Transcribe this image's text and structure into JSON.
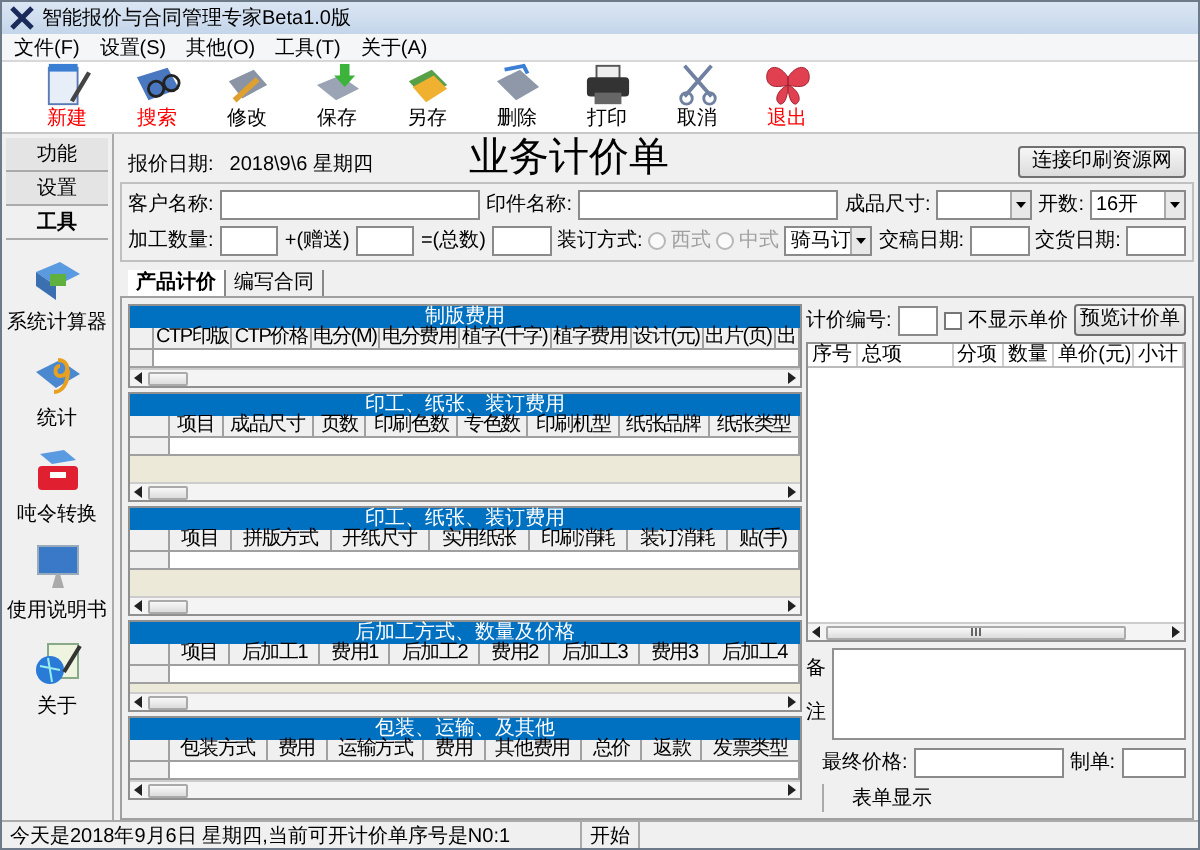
{
  "window": {
    "title": "智能报价与合同管理专家Beta1.0版"
  },
  "menu": [
    "文件(F)",
    "设置(S)",
    "其他(O)",
    "工具(T)",
    "关于(A)"
  ],
  "toolbar": [
    {
      "label": "新建",
      "kind": "new",
      "color": "#ff0000"
    },
    {
      "label": "搜索",
      "kind": "search",
      "color": "#ff0000"
    },
    {
      "label": "修改",
      "kind": "edit",
      "color": "#000000"
    },
    {
      "label": "保存",
      "kind": "save",
      "color": "#000000"
    },
    {
      "label": "另存",
      "kind": "saveas",
      "color": "#000000"
    },
    {
      "label": "删除",
      "kind": "delete",
      "color": "#000000"
    },
    {
      "label": "打印",
      "kind": "print",
      "color": "#000000"
    },
    {
      "label": "取消",
      "kind": "cancel",
      "color": "#000000"
    },
    {
      "label": "退出",
      "kind": "exit",
      "color": "#ff0000"
    }
  ],
  "sidebar": {
    "tabs": [
      {
        "label": "功能",
        "selected": false
      },
      {
        "label": "设置",
        "selected": false
      },
      {
        "label": "工具",
        "selected": true
      }
    ],
    "items": [
      {
        "label": "系统计算器",
        "kind": "computer"
      },
      {
        "label": "统计",
        "kind": "nine"
      },
      {
        "label": "吨令转换",
        "kind": "toolbox"
      },
      {
        "label": "使用说明书",
        "kind": "monitor"
      },
      {
        "label": "关于",
        "kind": "globe"
      }
    ]
  },
  "header": {
    "date_label": "报价日期:",
    "date": "2018\\9\\6 星期四",
    "title": "业务计价单",
    "link_button": "连接印刷资源网"
  },
  "form": {
    "top_fields": [
      {
        "kind": "text",
        "label": "客户名称:"
      },
      {
        "kind": "text",
        "label": "印件名称:"
      },
      {
        "kind": "select",
        "label": "成品尺寸:"
      },
      {
        "kind": "select",
        "label": "开数:",
        "value": "16开"
      }
    ],
    "bottom_fields": [
      {
        "kind": "text",
        "label": "加工数量:"
      },
      {
        "kind": "text",
        "label": "+(赠送)"
      },
      {
        "kind": "text",
        "label": "=(总数)"
      },
      {
        "kind": "radio_group",
        "label": "装订方式:",
        "options": [
          {
            "label": "西式",
            "selected": false,
            "disabled": true
          },
          {
            "label": "中式",
            "selected": false,
            "disabled": true
          }
        ]
      },
      {
        "kind": "select",
        "value": "骑马订"
      },
      {
        "kind": "text",
        "label": "交稿日期:"
      },
      {
        "kind": "text",
        "label": "交货日期:"
      }
    ]
  },
  "tabs": [
    {
      "label": "产品计价",
      "selected": true
    },
    {
      "label": "编写合同",
      "selected": false
    }
  ],
  "grids": [
    {
      "title": "制版费用",
      "columns": [
        "CTP印版",
        "CTP价格",
        "电分(M)",
        "电分费用",
        "植字(千字)",
        "植字费用",
        "设计(元)",
        "出片(页)",
        "出"
      ]
    },
    {
      "title": "印工、纸张、装订费用",
      "columns": [
        "项目",
        "成品尺寸",
        "页数",
        "印刷色数",
        "专色数",
        "印刷机型",
        "纸张品牌",
        "纸张类型"
      ]
    },
    {
      "title": "印工、纸张、装订费用",
      "columns": [
        "项目",
        "拼版方式",
        "开纸尺寸",
        "实用纸张",
        "印刷消耗",
        "装订消耗",
        "贴(手)"
      ]
    },
    {
      "title": "后加工方式、数量及价格",
      "columns": [
        "项目",
        "后加工1",
        "费用1",
        "后加工2",
        "费用2",
        "后加工3",
        "费用3",
        "后加工4"
      ]
    },
    {
      "title": "包装、运输、及其他",
      "columns": [
        "包装方式",
        "费用",
        "运输方式",
        "费用",
        "其他费用",
        "总价",
        "返款",
        "发票类型"
      ]
    }
  ],
  "right": {
    "number_label": "计价编号:",
    "hide_price": {
      "label": "不显示单价",
      "checked": false
    },
    "preview_button": "预览计价单",
    "list_columns": [
      "序号",
      "总项",
      "分项",
      "数量",
      "单价(元)",
      "小计"
    ],
    "remarks_label": "备注",
    "final_price_label": "最终价格:",
    "maker_label": "制单:",
    "form_status": "表单显示"
  },
  "status_bar": [
    "今天是2018年9月6日 星期四,当前可开计价单序号是N0:1",
    "开始"
  ]
}
